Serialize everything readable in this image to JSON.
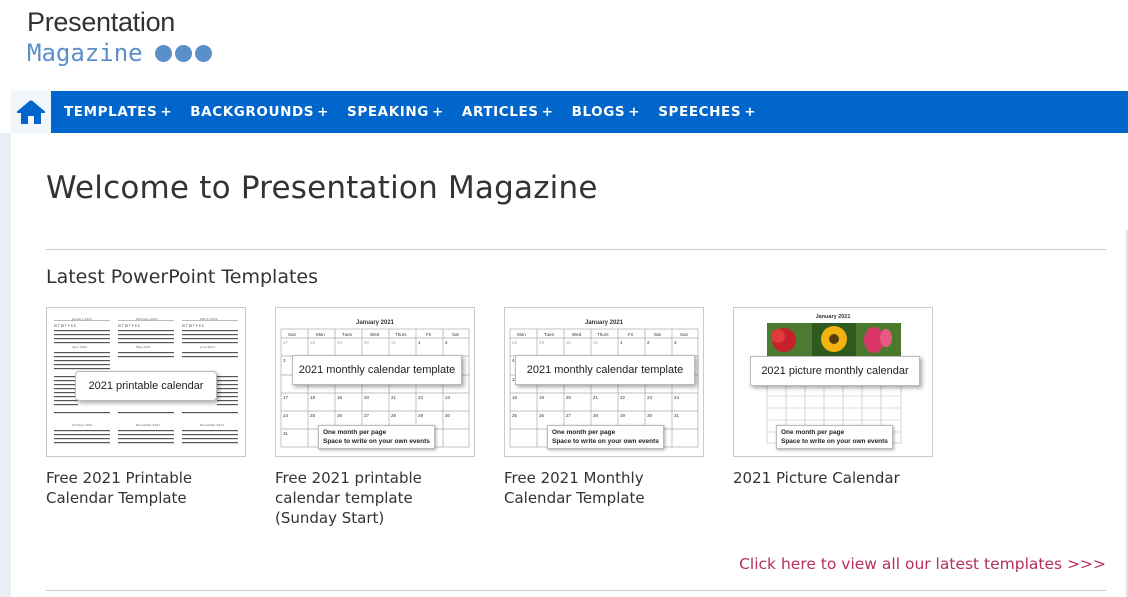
{
  "logo": {
    "line1": "Presentation",
    "line2": "Magazine"
  },
  "nav": {
    "home_icon": "home-icon",
    "items": [
      {
        "label": "TEMPLATES",
        "plus": "+"
      },
      {
        "label": "BACKGROUNDS",
        "plus": "+"
      },
      {
        "label": "SPEAKING",
        "plus": "+"
      },
      {
        "label": "ARTICLES",
        "plus": "+"
      },
      {
        "label": "BLOGS",
        "plus": "+"
      },
      {
        "label": "SPEECHES",
        "plus": "+"
      }
    ]
  },
  "main": {
    "title": "Welcome to Presentation Magazine",
    "section_title": "Latest PowerPoint Templates",
    "cards": [
      {
        "title": "Free 2021 Printable Calendar Template",
        "banner": "2021 printable calendar"
      },
      {
        "title": "Free 2021 printable calendar template (Sunday Start)",
        "banner": "2021 monthly calendar template",
        "month": "January 2021",
        "note1": "One month per page",
        "note2": "Space to write on your own events"
      },
      {
        "title": "Free 2021 Monthly Calendar Template",
        "banner": "2021 monthly calendar template",
        "month": "January 2021",
        "note1": "One month per page",
        "note2": "Space to write on your own events"
      },
      {
        "title": "2021 Picture Calendar",
        "banner": "2021 picture monthly calendar",
        "month": "January 2021",
        "note1": "One month per page",
        "note2": "Space to write on your own events"
      }
    ],
    "more_link": "Click here to view all our latest templates >>>"
  },
  "colors": {
    "nav_bg": "#0066cc",
    "logo_accent": "#5b8fc9",
    "link": "#b5305a"
  }
}
